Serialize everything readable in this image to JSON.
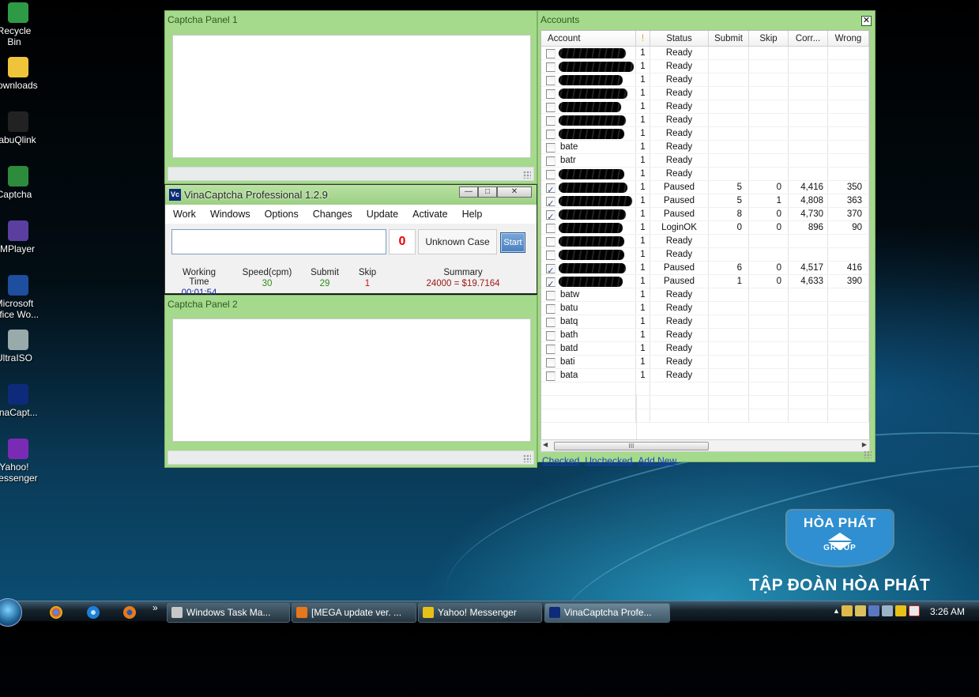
{
  "desktop_icons": [
    {
      "label": "Recycle\nBin",
      "icon": "recycle-bin-icon"
    },
    {
      "label": "Downloads",
      "icon": "folder-icon"
    },
    {
      "label": "BabuQlink",
      "icon": "qlink-icon"
    },
    {
      "label": "Captcha",
      "icon": "captcha-app-icon"
    },
    {
      "label": "KMPlayer",
      "icon": "kmplayer-icon"
    },
    {
      "label": "Microsoft\nOffice Wo...",
      "icon": "word-icon"
    },
    {
      "label": "UltraISO",
      "icon": "disc-icon"
    },
    {
      "label": "VinaCapt...",
      "icon": "vinacaptcha-icon"
    },
    {
      "label": "Yahoo!\nMessenger",
      "icon": "yahoo-icon"
    }
  ],
  "panel1": {
    "title": "Captcha Panel 1"
  },
  "panel2": {
    "title": "Captcha Panel 2"
  },
  "vina": {
    "title": "VinaCaptcha Professional 1.2.9",
    "logo": "Vc",
    "min": "—",
    "max": "□",
    "close": "✕",
    "menu": [
      "Work",
      "Windows",
      "Options",
      "Changes",
      "Update",
      "Activate",
      "Help"
    ],
    "count": "0",
    "case_label": "Unknown Case",
    "start_label": "Start",
    "stats": [
      {
        "label": "Working Time",
        "value": "00:01:54",
        "color": "#1a2a9a"
      },
      {
        "label": "Speed(cpm)",
        "value": "30",
        "color": "#2f8a1f"
      },
      {
        "label": "Submit",
        "value": "29",
        "color": "#2f8a1f"
      },
      {
        "label": "Skip",
        "value": "1",
        "color": "#c01818"
      },
      {
        "label": "Summary",
        "value": "24000 = $19.7164",
        "color": "#a01818"
      }
    ]
  },
  "accounts": {
    "title": "Accounts",
    "close": "✕",
    "columns": [
      "Account",
      "!",
      "Status",
      "Submit",
      "Skip",
      "Corr...",
      "Wrong"
    ],
    "rows": [
      {
        "account": "",
        "checked": false,
        "excl": "1",
        "status": "Ready",
        "submit": "",
        "skip": "",
        "correct": "",
        "wrong": ""
      },
      {
        "account": "",
        "checked": false,
        "excl": "1",
        "status": "Ready",
        "submit": "",
        "skip": "",
        "correct": "",
        "wrong": ""
      },
      {
        "account": "",
        "checked": false,
        "excl": "1",
        "status": "Ready",
        "submit": "",
        "skip": "",
        "correct": "",
        "wrong": ""
      },
      {
        "account": "",
        "checked": false,
        "excl": "1",
        "status": "Ready",
        "submit": "",
        "skip": "",
        "correct": "",
        "wrong": ""
      },
      {
        "account": "",
        "checked": false,
        "excl": "1",
        "status": "Ready",
        "submit": "",
        "skip": "",
        "correct": "",
        "wrong": ""
      },
      {
        "account": "",
        "checked": false,
        "excl": "1",
        "status": "Ready",
        "submit": "",
        "skip": "",
        "correct": "",
        "wrong": ""
      },
      {
        "account": "",
        "checked": false,
        "excl": "1",
        "status": "Ready",
        "submit": "",
        "skip": "",
        "correct": "",
        "wrong": ""
      },
      {
        "account": "bate",
        "checked": false,
        "excl": "1",
        "status": "Ready",
        "submit": "",
        "skip": "",
        "correct": "",
        "wrong": ""
      },
      {
        "account": "batr",
        "checked": false,
        "excl": "1",
        "status": "Ready",
        "submit": "",
        "skip": "",
        "correct": "",
        "wrong": ""
      },
      {
        "account": "",
        "checked": false,
        "excl": "1",
        "status": "Ready",
        "submit": "",
        "skip": "",
        "correct": "",
        "wrong": ""
      },
      {
        "account": "",
        "checked": true,
        "excl": "1",
        "status": "Paused",
        "submit": "5",
        "skip": "0",
        "correct": "4,416",
        "wrong": "350"
      },
      {
        "account": "",
        "checked": true,
        "excl": "1",
        "status": "Paused",
        "submit": "5",
        "skip": "1",
        "correct": "4,808",
        "wrong": "363"
      },
      {
        "account": "",
        "checked": true,
        "excl": "1",
        "status": "Paused",
        "submit": "8",
        "skip": "0",
        "correct": "4,730",
        "wrong": "370"
      },
      {
        "account": "",
        "checked": false,
        "excl": "1",
        "status": "LoginOK",
        "submit": "0",
        "skip": "0",
        "correct": "896",
        "wrong": "90"
      },
      {
        "account": "",
        "checked": false,
        "excl": "1",
        "status": "Ready",
        "submit": "",
        "skip": "",
        "correct": "",
        "wrong": ""
      },
      {
        "account": "",
        "checked": false,
        "excl": "1",
        "status": "Ready",
        "submit": "",
        "skip": "",
        "correct": "",
        "wrong": ""
      },
      {
        "account": "",
        "checked": true,
        "excl": "1",
        "status": "Paused",
        "submit": "6",
        "skip": "0",
        "correct": "4,517",
        "wrong": "416"
      },
      {
        "account": "",
        "checked": true,
        "excl": "1",
        "status": "Paused",
        "submit": "1",
        "skip": "0",
        "correct": "4,633",
        "wrong": "390"
      },
      {
        "account": "batw",
        "checked": false,
        "excl": "1",
        "status": "Ready",
        "submit": "",
        "skip": "",
        "correct": "",
        "wrong": ""
      },
      {
        "account": "batu",
        "checked": false,
        "excl": "1",
        "status": "Ready",
        "submit": "",
        "skip": "",
        "correct": "",
        "wrong": ""
      },
      {
        "account": "batq",
        "checked": false,
        "excl": "1",
        "status": "Ready",
        "submit": "",
        "skip": "",
        "correct": "",
        "wrong": ""
      },
      {
        "account": "bath",
        "checked": false,
        "excl": "1",
        "status": "Ready",
        "submit": "",
        "skip": "",
        "correct": "",
        "wrong": ""
      },
      {
        "account": "batd",
        "checked": false,
        "excl": "1",
        "status": "Ready",
        "submit": "",
        "skip": "",
        "correct": "",
        "wrong": ""
      },
      {
        "account": "bati",
        "checked": false,
        "excl": "1",
        "status": "Ready",
        "submit": "",
        "skip": "",
        "correct": "",
        "wrong": ""
      },
      {
        "account": "bata",
        "checked": false,
        "excl": "1",
        "status": "Ready",
        "submit": "",
        "skip": "",
        "correct": "",
        "wrong": ""
      }
    ],
    "scroll_thumb": "III",
    "scroll_left": "◀",
    "scroll_right": "▶",
    "links": [
      "Checked",
      "Unchecked",
      "Add New"
    ]
  },
  "brand": {
    "logo_name": "HÒA PHÁT",
    "logo_sub": "GROUP",
    "slogan": "TẬP ĐOÀN HÒA PHÁT"
  },
  "taskbar": {
    "chevron": "»",
    "buttons": [
      {
        "label": "Windows Task Ma...",
        "icon": "task-manager-icon",
        "color": "#c7c7c7"
      },
      {
        "label": "[MEGA update ver. ...",
        "icon": "firefox-icon",
        "color": "#e8761a"
      },
      {
        "label": "Yahoo! Messenger",
        "icon": "yahoo-icon",
        "color": "#e8c018"
      },
      {
        "label": "VinaCaptcha Profe...",
        "icon": "vinacaptcha-icon",
        "color": "#0d2b7a"
      }
    ],
    "clock": "3:26 AM"
  }
}
